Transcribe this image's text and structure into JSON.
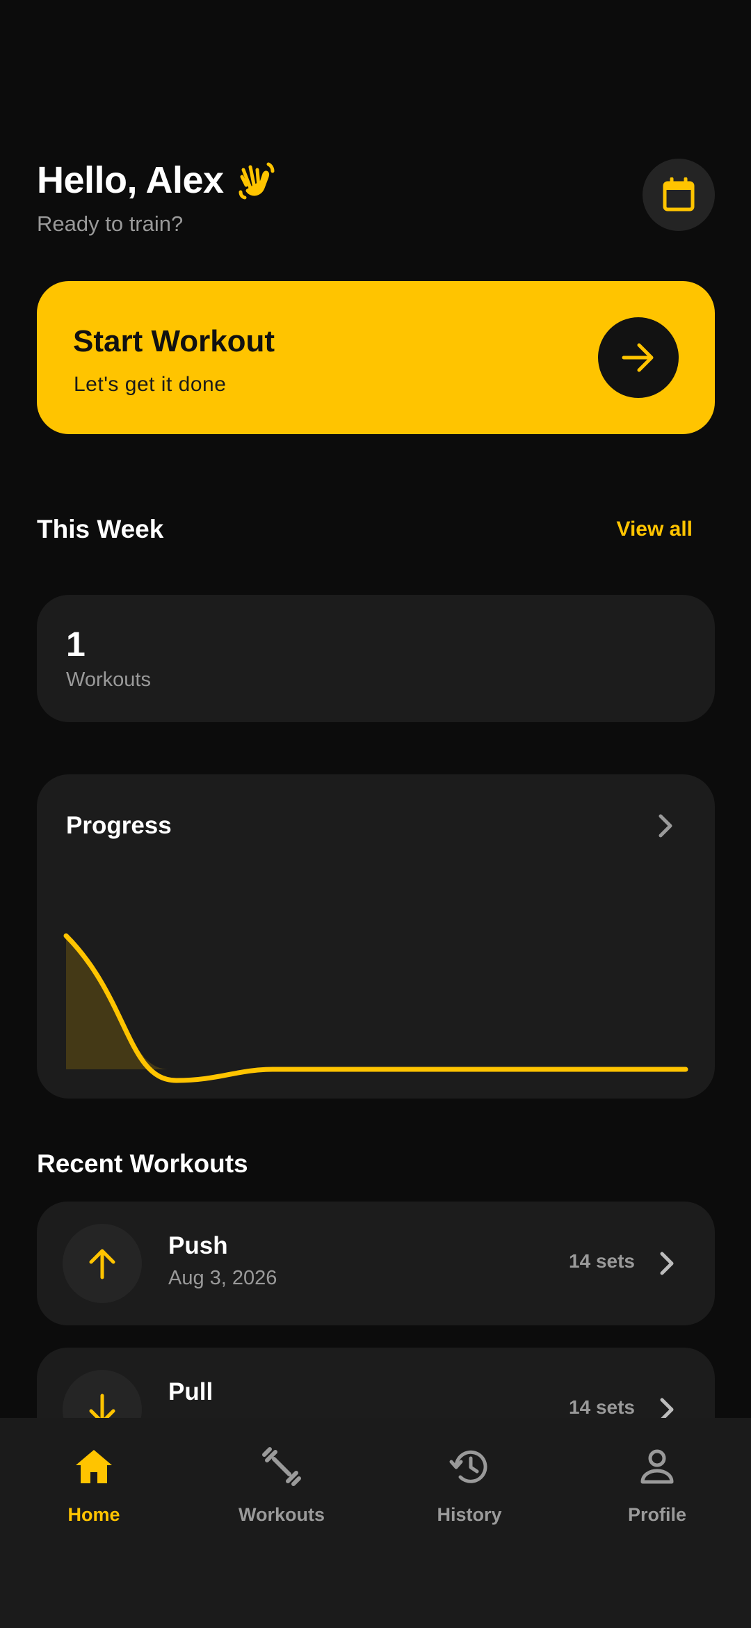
{
  "header": {
    "greeting": "Hello, Alex",
    "subtitle": "Ready to train?",
    "wave_icon": "waving-hand-icon",
    "calendar_icon": "calendar-icon"
  },
  "start_card": {
    "title": "Start Workout",
    "subtitle": "Let's get it done",
    "arrow_icon": "arrow-right-icon"
  },
  "this_week": {
    "title": "This Week",
    "view_all": "View all",
    "stat_value": "1",
    "stat_label": "Workouts"
  },
  "progress": {
    "title": "Progress",
    "chevron_icon": "chevron-right-icon"
  },
  "chart_data": {
    "type": "area",
    "x": [
      0,
      1,
      2,
      3,
      4,
      5,
      6
    ],
    "values": [
      1,
      0,
      0,
      0,
      0,
      0,
      0
    ],
    "ylim": [
      0,
      1
    ]
  },
  "recent": {
    "title": "Recent Workouts",
    "items": [
      {
        "name": "Push",
        "date": "Aug 3, 2026",
        "sets": "14 sets",
        "icon": "arrow-up-icon"
      },
      {
        "name": "Pull",
        "date": "",
        "sets": "14 sets",
        "icon": "arrow-down-icon"
      }
    ]
  },
  "nav": {
    "items": [
      {
        "label": "Home",
        "icon": "home-icon",
        "active": true
      },
      {
        "label": "Workouts",
        "icon": "dumbbell-icon",
        "active": false
      },
      {
        "label": "History",
        "icon": "history-icon",
        "active": false
      },
      {
        "label": "Profile",
        "icon": "person-icon",
        "active": false
      }
    ]
  },
  "colors": {
    "accent": "#ffc400",
    "background": "#0c0c0c",
    "card": "#1c1c1c",
    "muted_text": "#9a9a9a"
  }
}
